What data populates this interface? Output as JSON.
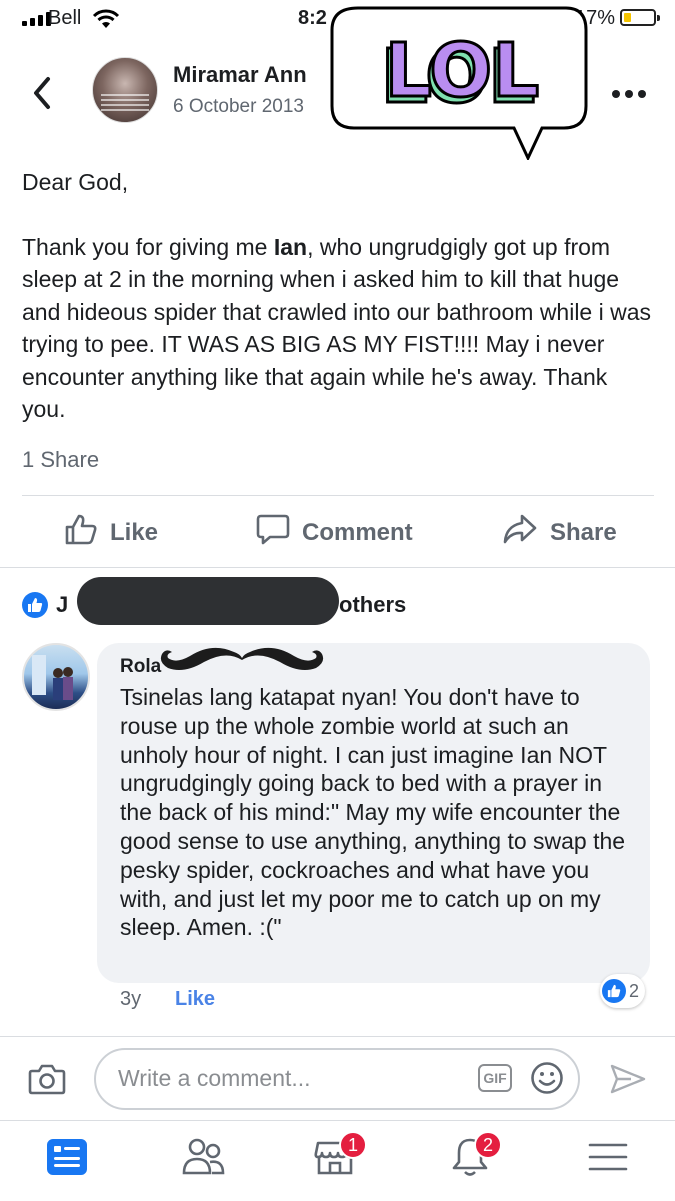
{
  "status_bar": {
    "carrier": "Bell",
    "time": "8:2",
    "battery_percent": "17%",
    "battery_level": 0.17
  },
  "header": {
    "author": "Miramar Ann",
    "date": "6 October 2013",
    "back_icon": "chevron-left-icon",
    "more_icon": "more-horizontal-icon"
  },
  "sticker": {
    "text": "LOL",
    "colors": {
      "fill": "#b98df0",
      "shade": "#7fe0b0",
      "outline": "#000000"
    }
  },
  "post": {
    "greeting": "Dear God,",
    "body_pre": "Thank you for giving me ",
    "body_bold": "Ian",
    "body_post": ", who ungrudgigly got up from sleep at 2 in the morning when i asked him to kill that huge and hideous spider that crawled into our bathroom while i was trying to pee. IT WAS AS BIG AS MY FIST!!!! May i never encounter anything like that again while he's away. Thank you.",
    "shares": "1 Share"
  },
  "actions": {
    "like": "Like",
    "comment": "Comment",
    "share": "Share"
  },
  "reactions": {
    "prefix": "J",
    "suffix": "others"
  },
  "comment": {
    "author": "Rola",
    "text": "Tsinelas lang katapat nyan! You don't have to rouse up the whole zombie world at such an unholy hour of night. I can just imagine Ian NOT ungrudgingly going back to bed with a prayer in the back of his mind:\" May my wife encounter the good sense to use anything, anything to swap the pesky spider, cockroaches and what have you with, and just let my poor me to catch up on my sleep. Amen. :(\"",
    "time": "3y",
    "like_label": "Like",
    "reaction_count": "2"
  },
  "composer": {
    "placeholder": "Write a comment...",
    "gif_label": "GIF"
  },
  "nav": {
    "items": [
      {
        "icon": "news-feed-icon",
        "active": true,
        "badge": ""
      },
      {
        "icon": "friends-icon",
        "active": false,
        "badge": ""
      },
      {
        "icon": "marketplace-icon",
        "active": false,
        "badge": "1"
      },
      {
        "icon": "notifications-icon",
        "active": false,
        "badge": "2"
      },
      {
        "icon": "menu-icon",
        "active": false,
        "badge": ""
      }
    ]
  },
  "colors": {
    "accent": "#1877f2",
    "link": "#4a83e6",
    "badge": "#e41e3f",
    "muted": "#606770",
    "bubble": "#f0f2f5"
  }
}
